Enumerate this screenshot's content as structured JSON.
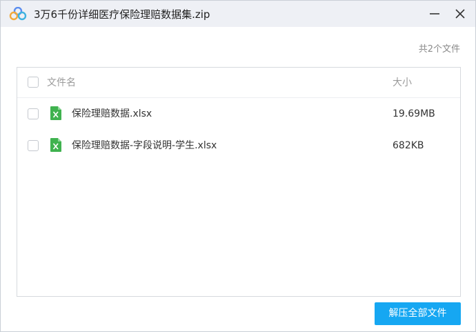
{
  "window": {
    "title": "3万6千份详细医疗保险理赔数据集.zip",
    "app_icon": "cloud-logo-icon",
    "minimize_icon": "minimize-icon",
    "close_icon": "close-icon"
  },
  "summary": {
    "file_count": "共2个文件"
  },
  "table": {
    "columns": [
      "文件名",
      "大小"
    ],
    "rows": [
      {
        "name": "保险理赔数据.xlsx",
        "size": "19.69MB",
        "icon": "excel-file-icon"
      },
      {
        "name": "保险理赔数据-字段说明-学生.xlsx",
        "size": "682KB",
        "icon": "excel-file-icon"
      }
    ]
  },
  "actions": {
    "extract_all": "解压全部文件"
  },
  "colors": {
    "accent": "#16a7f2",
    "titlebar": "#eef0f5",
    "excel_green": "#3fb24f"
  }
}
